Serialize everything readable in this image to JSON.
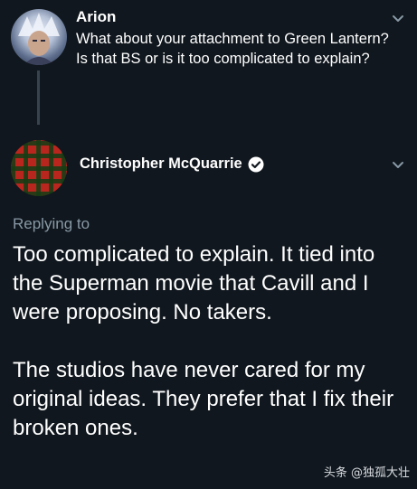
{
  "parent_tweet": {
    "author": "Arion",
    "text": "What about your attachment to Green Lantern? Is that BS or is it too complicated to explain?"
  },
  "main_tweet": {
    "author": "Christopher McQuarrie",
    "verified": true,
    "replying_to": "Replying to",
    "paragraphs": [
      "Too complicated to explain. It tied into the Superman movie that Cavill and I were proposing. No takers.",
      "The studios have never cared for my original ideas. They prefer that I fix their broken ones."
    ]
  },
  "watermark": "头条 @独孤大壮",
  "colors": {
    "background": "#10171e",
    "text": "#ffffff",
    "secondary_text": "#8899a6",
    "thread_line": "#38444d",
    "chevron": "#8899a6",
    "verified_badge": "#ffffff"
  },
  "icons": {
    "chevron": "chevron-down-icon",
    "verified": "verified-badge-icon"
  }
}
